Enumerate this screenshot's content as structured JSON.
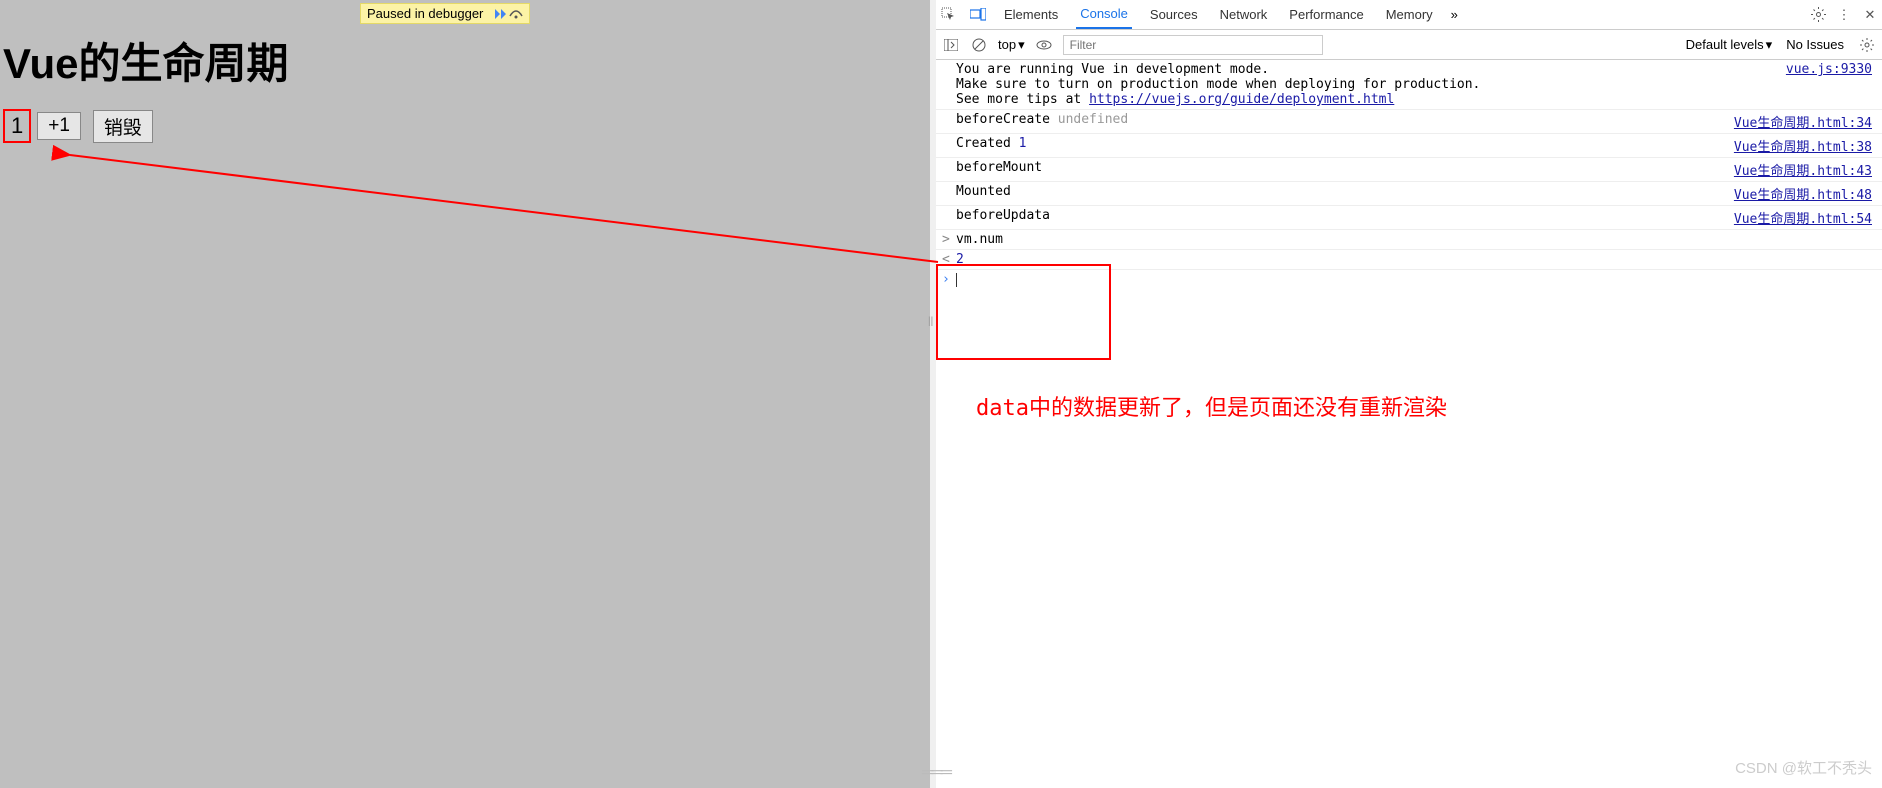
{
  "debug_banner": {
    "text": "Paused in debugger"
  },
  "page": {
    "title": "Vue的生命周期",
    "counter_value": "1",
    "btn_plus": "+1",
    "btn_destroy": "销毁"
  },
  "devtools": {
    "tabs": {
      "elements": "Elements",
      "console": "Console",
      "sources": "Sources",
      "network": "Network",
      "performance": "Performance",
      "memory": "Memory"
    },
    "toolbar": {
      "context": "top",
      "filter_placeholder": "Filter",
      "levels": "Default levels",
      "issues": "No Issues"
    },
    "logs": [
      {
        "text": "You are running Vue in development mode.\nMake sure to turn on production mode when deploying for production.\nSee more tips at ",
        "link_inline": "https://vuejs.org/guide/deployment.html",
        "source": "vue.js:9330"
      },
      {
        "prefix": "beforeCreate ",
        "gray": "undefined",
        "source": "Vue生命周期.html:34"
      },
      {
        "prefix": "Created ",
        "num": "1",
        "source": "Vue生命周期.html:38"
      },
      {
        "prefix": "beforeMount",
        "source": "Vue生命周期.html:43"
      },
      {
        "prefix": "Mounted",
        "source": "Vue生命周期.html:48"
      },
      {
        "prefix": "beforeUpdata",
        "source": "Vue生命周期.html:54"
      },
      {
        "marker": ">",
        "prefix": "vm.num"
      },
      {
        "marker": "<",
        "num": "2"
      }
    ]
  },
  "annotation": "data中的数据更新了，但是页面还没有重新渲染",
  "watermark": "CSDN @软工不秃头"
}
